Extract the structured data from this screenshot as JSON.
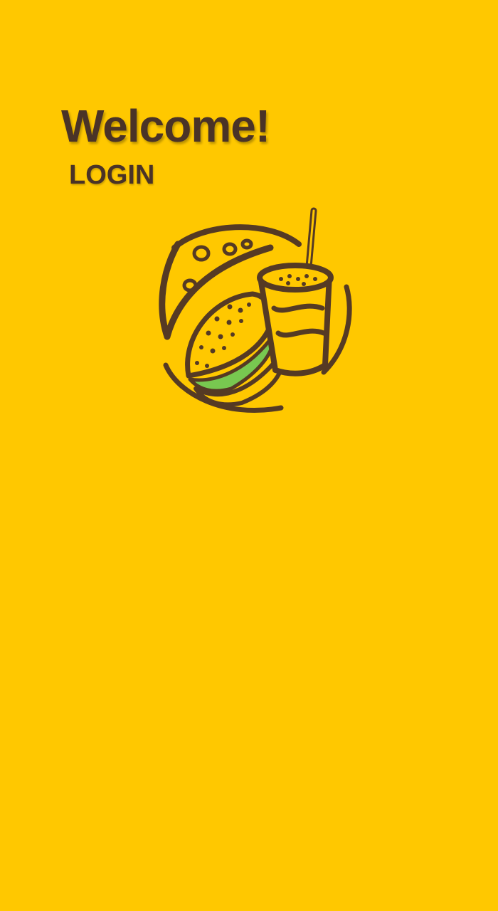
{
  "header": {
    "title": "Welcome!",
    "subtitle": "LOGIN"
  },
  "logo": {
    "icon": "burger-and-drink-icon"
  },
  "colors": {
    "background": "#FFC800",
    "text": "#4A3327",
    "logo_stroke": "#553A24",
    "logo_fill": "#FFC800",
    "lettuce": "#78C850"
  }
}
